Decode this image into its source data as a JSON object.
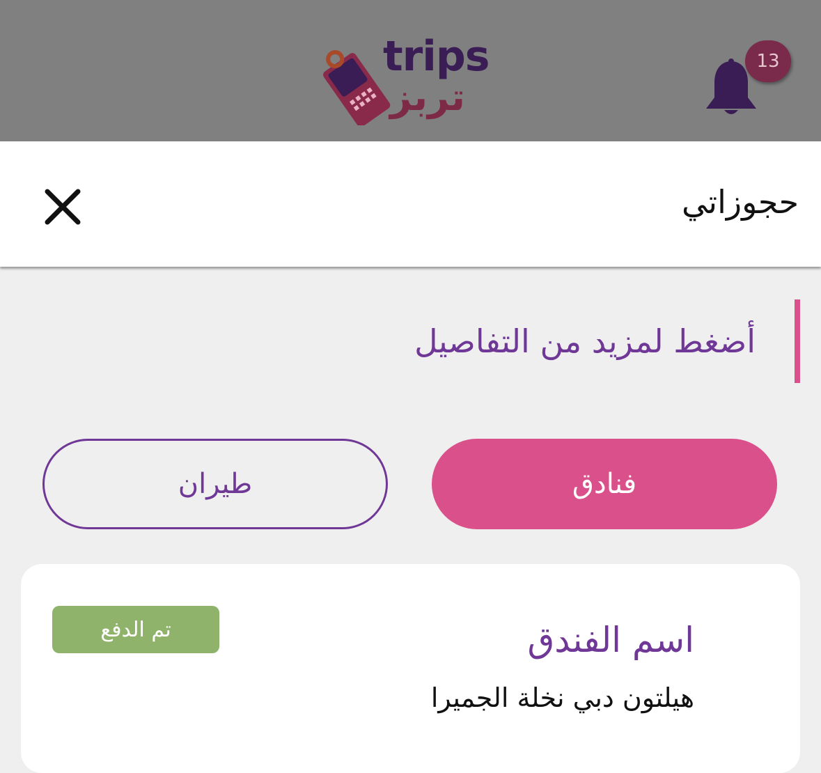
{
  "topbar": {
    "logo": {
      "en": "trips",
      "ar": "تربز"
    },
    "notifications": {
      "count": "13",
      "icon": "bell-icon"
    }
  },
  "header": {
    "title": "حجوزاتي",
    "close_icon": "close-icon"
  },
  "hint": {
    "text": "أضغط لمزيد من التفاصيل"
  },
  "tabs": [
    {
      "label": "فنادق",
      "active": true
    },
    {
      "label": "طيران",
      "active": false
    }
  ],
  "booking": {
    "status": "تم الدفع",
    "hotel_label": "اسم الفندق",
    "hotel_name": "هيلتون دبي نخلة الجميرا"
  },
  "colors": {
    "accent_pink": "#d9508a",
    "accent_purple": "#6f3796",
    "status_paid": "#8fb36a",
    "topbar_bg": "#808080"
  }
}
